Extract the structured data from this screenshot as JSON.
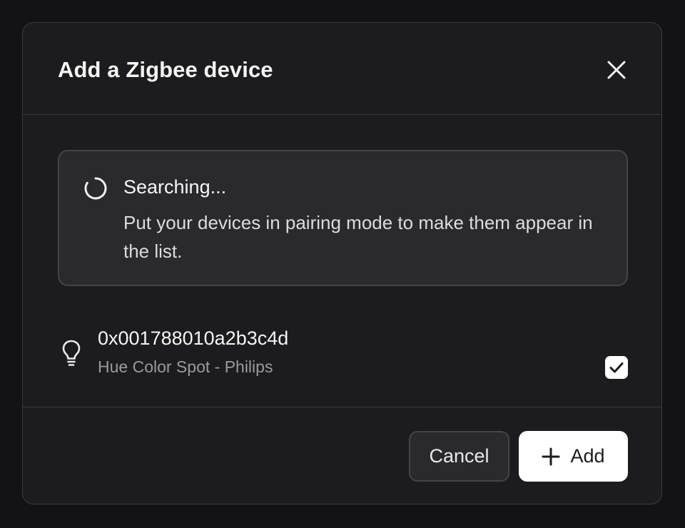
{
  "dialog": {
    "title": "Add a Zigbee device"
  },
  "status": {
    "title": "Searching...",
    "description": "Put your devices in pairing mode to make them appear in the list."
  },
  "devices": [
    {
      "id": "0x001788010a2b3c4d",
      "name": "Hue Color Spot - Philips",
      "icon": "lightbulb-icon",
      "checked": true
    }
  ],
  "footer": {
    "cancel_label": "Cancel",
    "add_label": "Add"
  },
  "icons": {
    "close": "close-icon",
    "spinner": "spinner-icon",
    "check": "checkmark-icon",
    "plus": "plus-icon"
  },
  "colors": {
    "background": "#131315",
    "dialog": "#1c1c1e",
    "card": "#2a2a2d",
    "border": "#444448",
    "primary_button": "#ffffff",
    "muted_text": "#9a9a9f"
  }
}
